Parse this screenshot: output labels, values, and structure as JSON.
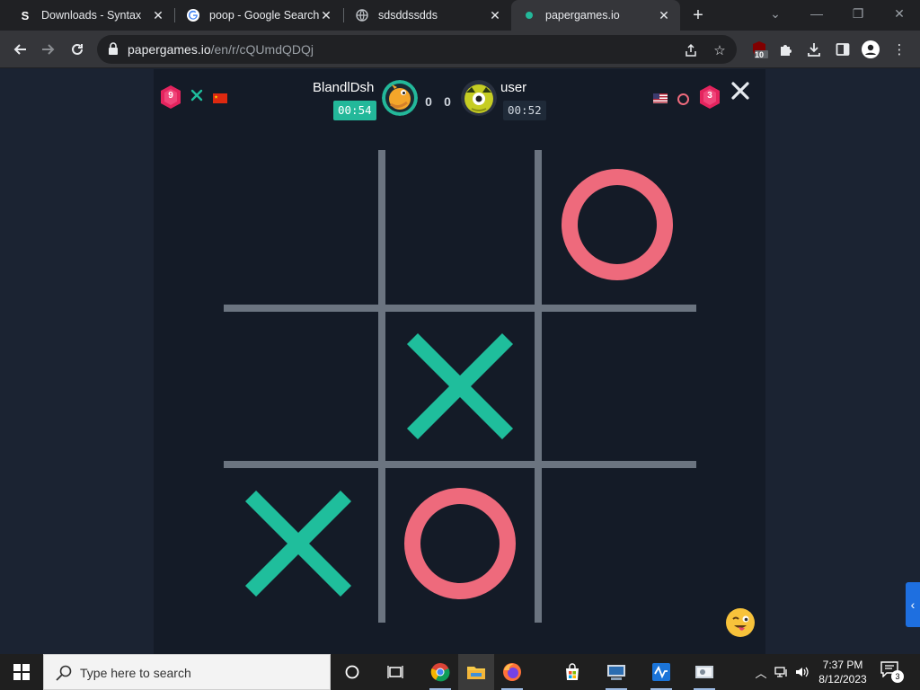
{
  "browser": {
    "tabs": [
      {
        "title": "Downloads - Syntax",
        "favicon": "syntax-s-icon",
        "favicon_glyph": "S"
      },
      {
        "title": "poop - Google Search",
        "favicon": "google-icon"
      },
      {
        "title": "sdsddssdds",
        "favicon": "globe-icon"
      },
      {
        "title": "papergames.io",
        "favicon": "papergames-dot-icon",
        "active": true
      }
    ],
    "url_host": "papergames.io",
    "url_path": "/en/r/cQUmdQDQj",
    "extension_badge": "10"
  },
  "game": {
    "player_left": {
      "name": "BlandlDsh",
      "timer": "00:54",
      "level": "9",
      "symbol": "X",
      "flag": "china-flag",
      "score": "0",
      "avatar": "orange-character-avatar"
    },
    "player_right": {
      "name": "user",
      "timer": "00:52",
      "level": "3",
      "symbol": "O",
      "flag": "usa-flag",
      "score": "0",
      "avatar": "green-one-eyed-avatar"
    },
    "board": [
      [
        "",
        "",
        "O"
      ],
      [
        "",
        "X",
        ""
      ],
      [
        "X",
        "O",
        ""
      ]
    ],
    "colors": {
      "x": "#1fbe9c",
      "o": "#ee6a7c",
      "grid": "#6b7480",
      "panel": "#141b27",
      "timer_active": "#23b89a"
    }
  },
  "taskbar": {
    "search_placeholder": "Type here to search",
    "time": "7:37 PM",
    "date": "8/12/2023",
    "notification_count": "3",
    "apps": [
      "task-view-icon",
      "chrome-icon",
      "file-explorer-icon",
      "firefox-icon",
      "microsoft-store-icon",
      "app-icon",
      "azure-data-icon",
      "app2-icon"
    ]
  }
}
